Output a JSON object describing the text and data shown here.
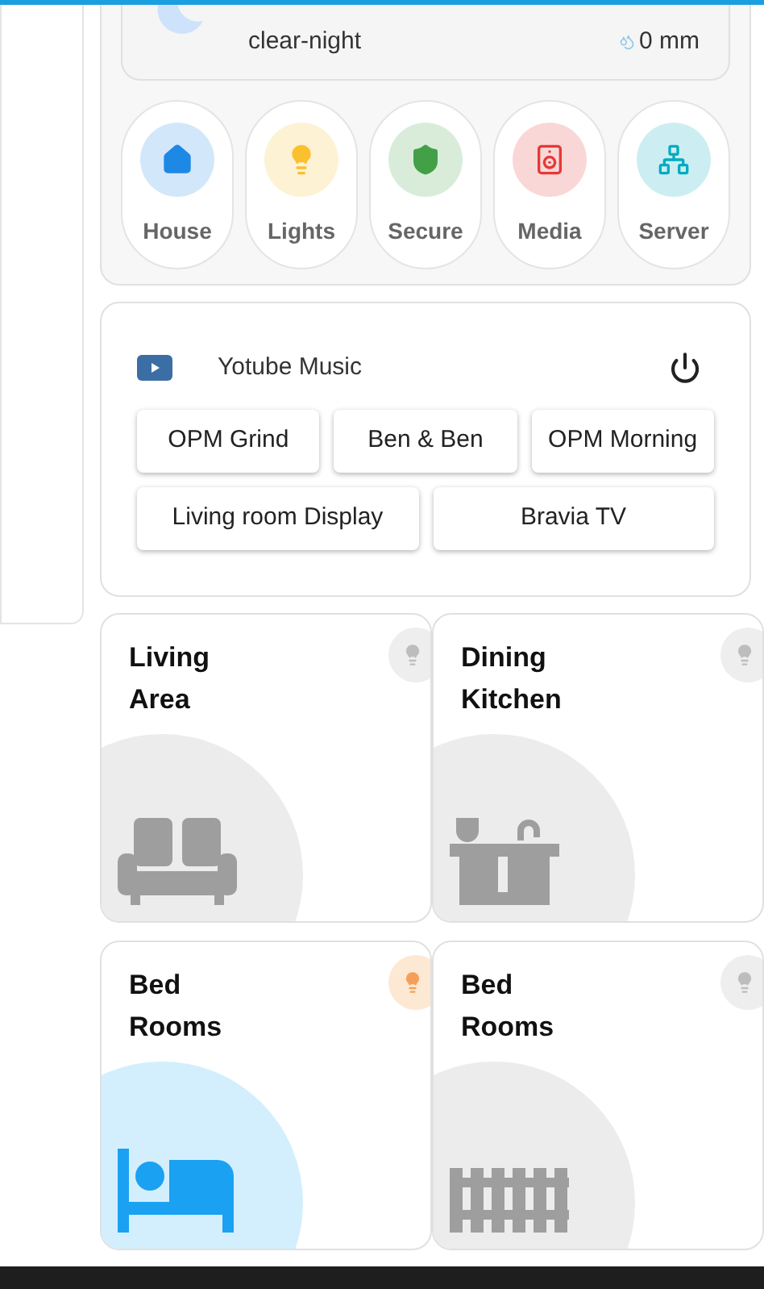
{
  "weather": {
    "condition": "clear-night",
    "precipitation": "0 mm"
  },
  "shortcuts": [
    {
      "label": "House",
      "kind": "house",
      "color": "#1e88e5"
    },
    {
      "label": "Lights",
      "kind": "bulb",
      "color": "#fbc02d"
    },
    {
      "label": "Secure",
      "kind": "shield",
      "color": "#43a047"
    },
    {
      "label": "Media",
      "kind": "speaker",
      "color": "#e53935"
    },
    {
      "label": "Server",
      "kind": "network",
      "color": "#00acc1"
    }
  ],
  "media": {
    "title": "Yotube Music",
    "on": false,
    "sources": [
      [
        "OPM Grind",
        "Ben & Ben",
        "OPM Morning"
      ],
      [
        "Living room Display",
        "Bravia TV"
      ]
    ]
  },
  "rooms": [
    [
      {
        "name": "Living Area",
        "kind": "sofa",
        "active": false,
        "light_on": false
      },
      {
        "name": "Dining Kitchen",
        "kind": "kitchen",
        "active": false,
        "light_on": false
      }
    ],
    [
      {
        "name": "Bed Rooms",
        "kind": "bed",
        "active": true,
        "light_on": true
      },
      {
        "name": "Bed Rooms",
        "kind": "fence",
        "active": false,
        "light_on": false
      }
    ]
  ]
}
